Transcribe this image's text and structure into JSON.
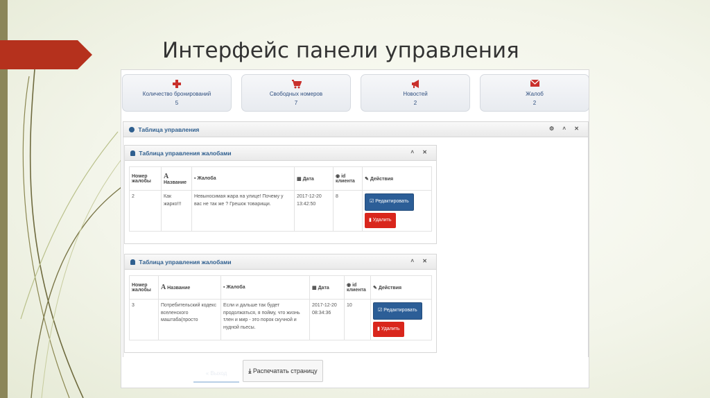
{
  "slide": {
    "title": "Интерфейс панели управления"
  },
  "stats": [
    {
      "label": "Количество бронирований",
      "value": "5",
      "icon": "plus-icon",
      "color": "#c9302c"
    },
    {
      "label": "Свободных номеров",
      "value": "7",
      "icon": "cart-icon",
      "color": "#c9302c"
    },
    {
      "label": "Новостей",
      "value": "2",
      "icon": "bullhorn-icon",
      "color": "#c9302c"
    },
    {
      "label": "Жалоб",
      "value": "2",
      "icon": "envelope-icon",
      "color": "#c9302c"
    }
  ],
  "main_panel": {
    "title": "Таблица управления",
    "controls": "⚙ ˄ ✕"
  },
  "complaint_panels": [
    {
      "title": "Таблица управления жалобами",
      "controls": "˄ ✕",
      "headers": {
        "number": "Номер жалобы",
        "name": "Название",
        "complaint": "Жалоба",
        "date": "Дата",
        "client": "id клиента",
        "actions": "Действия"
      },
      "row": {
        "number": "2",
        "name": "Как жарко!!!",
        "complaint": "Невыносимая жара на улице! Почему у вас не так же ? Грешок товарищи.",
        "date": "2017-12-20 13:42:50",
        "client": "8"
      },
      "edit_label": "Редактировать",
      "delete_label": "Удалить"
    },
    {
      "title": "Таблица управления жалобами",
      "controls": "˄ ✕",
      "headers": {
        "number": "Номер жалобы",
        "name": "Название",
        "complaint": "Жалоба",
        "date": "Дата",
        "client": "id клиента",
        "actions": "Действия"
      },
      "row": {
        "number": "3",
        "name": "Потребительский кодекс вселенского маштаба(просто",
        "complaint": "Если и дальше так будет продолжаться, я пойму, что жизнь тлен и мир - это порок скучной и нудной пьесы.",
        "date": "2017-12-20 08:34:36",
        "client": "10"
      },
      "edit_label": "Редактировать",
      "delete_label": "Удалить"
    }
  ],
  "footer": {
    "faded_label": "« Выход",
    "print_label": "Распечатать страницу"
  },
  "colors": {
    "accent": "#2c5e97",
    "danger": "#d9261c",
    "slide_red": "#b5311d",
    "slide_olive": "#8b8659"
  }
}
